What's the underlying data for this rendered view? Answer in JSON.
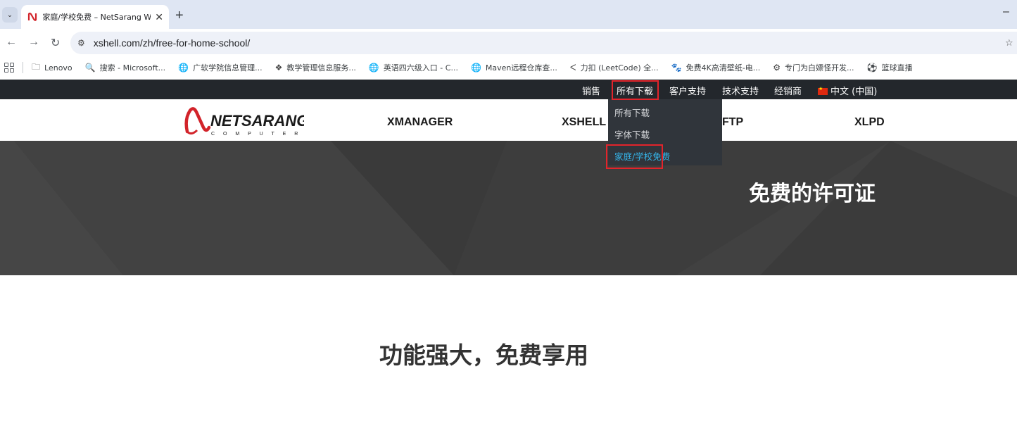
{
  "browser": {
    "tab": {
      "title": "家庭/学校免费 – NetSarang W",
      "close": "✕"
    },
    "new_tab": "+",
    "minimize": "–",
    "url": "xshell.com/zh/free-for-home-school/",
    "bookmarks": [
      {
        "icon": "folder-icon",
        "glyph": "🗀",
        "label": "Lenovo"
      },
      {
        "icon": "search-icon",
        "glyph": "🔍",
        "label": "搜索 - Microsoft..."
      },
      {
        "icon": "globe-icon",
        "glyph": "🌐",
        "label": "广软学院信息管理..."
      },
      {
        "icon": "dropbox-icon",
        "glyph": "❖",
        "label": "教学管理信息服务..."
      },
      {
        "icon": "globe-icon",
        "glyph": "🌐",
        "label": "英语四六级入口 - C..."
      },
      {
        "icon": "globe-icon",
        "glyph": "🌐",
        "label": "Maven远程仓库查..."
      },
      {
        "icon": "leetcode-icon",
        "glyph": "ᐸ",
        "label": "力扣 (LeetCode) 全..."
      },
      {
        "icon": "paw-icon",
        "glyph": "🐾",
        "label": "免费4K高清壁纸-电..."
      },
      {
        "icon": "gear-icon",
        "glyph": "⚙",
        "label": "专门为白嫖怪开发..."
      },
      {
        "icon": "ball-icon",
        "glyph": "⚽",
        "label": "篮球直播"
      }
    ]
  },
  "site": {
    "topbar": {
      "items": [
        "销售",
        "所有下载",
        "客户支持",
        "技术支持",
        "经销商"
      ],
      "language": "中文 (中国)"
    },
    "logo": {
      "name": "NETSARANG",
      "sub": "C O M P U T E R"
    },
    "nav": [
      "XMANAGER",
      "XSHELL",
      "FTP",
      "XLPD"
    ],
    "dropdown": [
      "所有下载",
      "字体下载",
      "家庭/学校免费"
    ],
    "hero_title": "免费的许可证",
    "headline": "功能强大，免费享用"
  },
  "colors": {
    "topbar_bg": "#23272c",
    "dropdown_bg": "#30353b",
    "active_link": "#35b4e8",
    "highlight_box": "#e3242b",
    "hero_bg": "#3d3d3d"
  }
}
